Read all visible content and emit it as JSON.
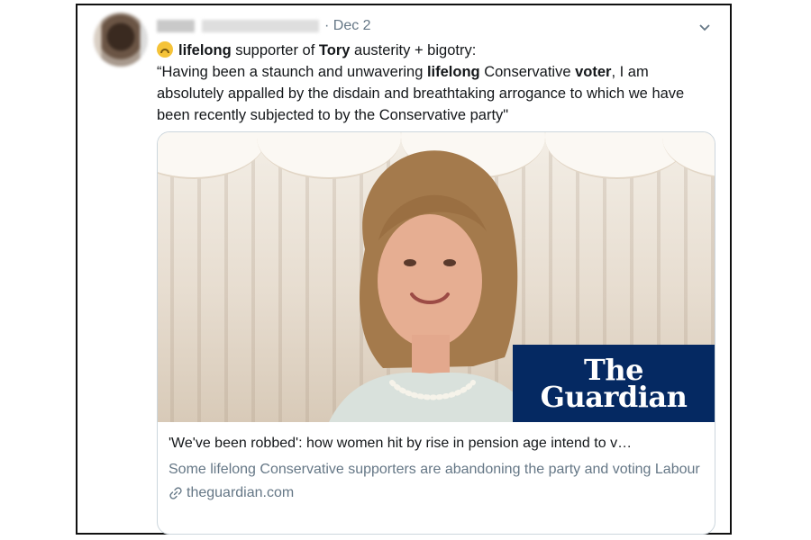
{
  "tweet": {
    "date_text": "· Dec 2",
    "text": {
      "line1_seg1": "lifelong",
      "line1_seg2": " supporter of ",
      "line1_seg3": "Tory",
      "line1_seg4": " austerity + bigotry:",
      "quote_seg1": "“Having been a staunch and unwavering ",
      "quote_seg2": "lifelong",
      "quote_seg3": " Conservative ",
      "quote_seg4": "voter",
      "quote_seg5": ", I am absolutely appalled by the disdain and breathtaking arrogance to which we have been recently subjected to by the Conservative party\""
    },
    "emoji": "upside-down-face-emoji",
    "menu_icon": "chevron-down-icon"
  },
  "card": {
    "logo_line1": "The",
    "logo_line2": "Guardian",
    "title": "'We've been robbed': how women hit by rise in pension age intend to v…",
    "description": "Some lifelong Conservative supporters are abandoning the party and voting Labour",
    "domain": "theguardian.com",
    "link_icon": "link-icon"
  },
  "colors": {
    "secondary_text": "#657786",
    "guardian_blue": "#052962",
    "card_border": "#ccd6dd"
  }
}
